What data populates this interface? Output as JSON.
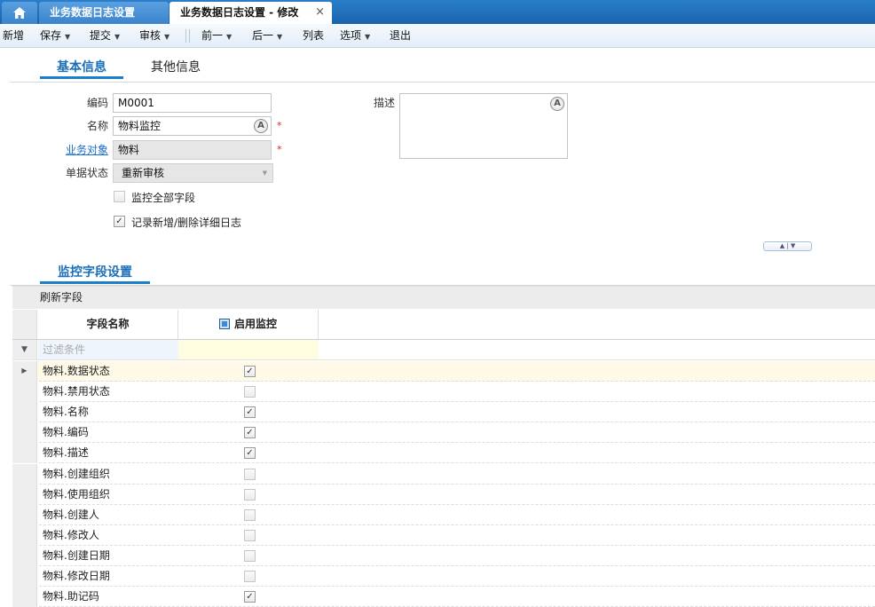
{
  "tabs": {
    "tab1": "业务数据日志设置",
    "tab2": "业务数据日志设置 - 修改",
    "close": "×"
  },
  "toolbar": {
    "new": "新增",
    "save": "保存",
    "submit": "提交",
    "audit": "审核",
    "prev": "前一",
    "next": "后一",
    "list": "列表",
    "options": "选项",
    "exit": "退出"
  },
  "section_tabs": {
    "basic": "基本信息",
    "other": "其他信息"
  },
  "form": {
    "code_label": "编码",
    "code_value": "M0001",
    "name_label": "名称",
    "name_value": "物料监控",
    "biz_object_label": "业务对象",
    "biz_object_value": "物料",
    "doc_status_label": "单据状态",
    "doc_status_value": "重新审核",
    "desc_label": "描述",
    "required_mark": "*",
    "monitor_all_label": "监控全部字段",
    "monitor_all_checked": false,
    "log_detail_label": "记录新增/删除详细日志",
    "log_detail_checked": true
  },
  "monitor_section": {
    "title": "监控字段设置",
    "refresh": "刷新字段",
    "col_field": "字段名称",
    "col_enable": "启用监控",
    "filter_placeholder": "过滤条件",
    "rows": [
      {
        "name": "物料.数据状态",
        "enabled": true
      },
      {
        "name": "物料.禁用状态",
        "enabled": false
      },
      {
        "name": "物料.名称",
        "enabled": true
      },
      {
        "name": "物料.编码",
        "enabled": true
      },
      {
        "name": "物料.描述",
        "enabled": true
      },
      {
        "name": "物料.创建组织",
        "enabled": false
      },
      {
        "name": "物料.使用组织",
        "enabled": false
      },
      {
        "name": "物料.创建人",
        "enabled": false
      },
      {
        "name": "物料.修改人",
        "enabled": false
      },
      {
        "name": "物料.创建日期",
        "enabled": false
      },
      {
        "name": "物料.修改日期",
        "enabled": false
      },
      {
        "name": "物料.助记码",
        "enabled": true
      }
    ]
  },
  "icons": {
    "home": "home-icon",
    "lookup": "lookup-icon",
    "dropdown": "chevron-down-icon",
    "filter": "filter-icon",
    "row_pointer": "row-pointer-icon"
  }
}
